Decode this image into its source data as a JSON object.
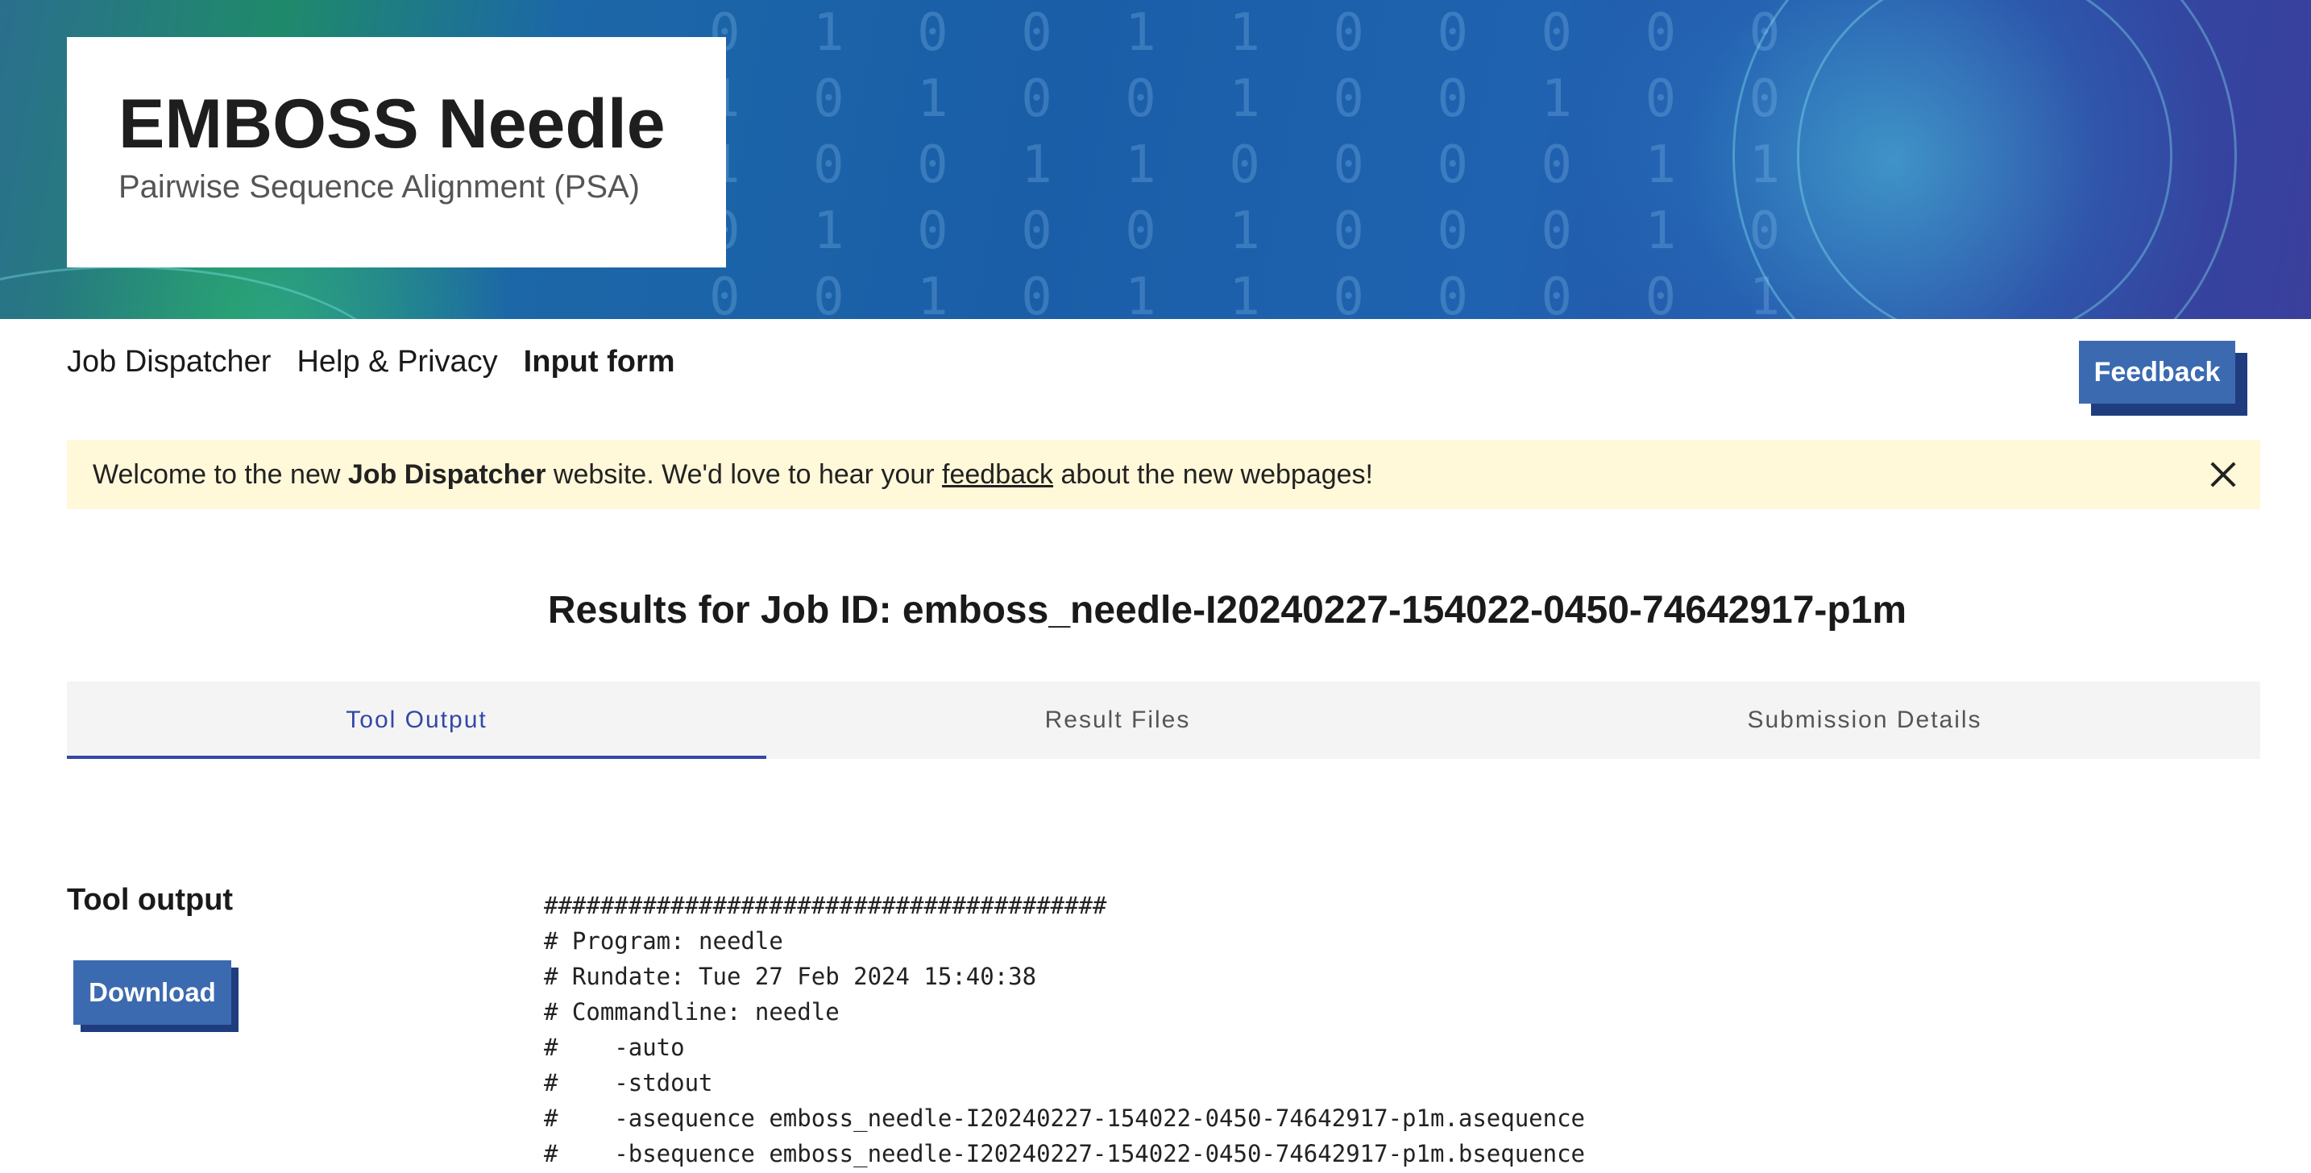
{
  "header": {
    "title": "EMBOSS Needle",
    "subtitle": "Pairwise Sequence Alignment (PSA)"
  },
  "nav": {
    "items": [
      {
        "label": "Job Dispatcher",
        "active": false
      },
      {
        "label": "Help & Privacy",
        "active": false
      },
      {
        "label": "Input form",
        "active": true
      }
    ],
    "feedback_label": "Feedback"
  },
  "banner": {
    "text_before": "Welcome to the new ",
    "bold": "Job Dispatcher",
    "text_middle": " website. We'd love to hear your ",
    "link": "feedback",
    "text_after": " about the new webpages!",
    "close_icon": "close-icon"
  },
  "results": {
    "title": "Results for Job ID: emboss_needle-I20240227-154022-0450-74642917-p1m"
  },
  "tabs": [
    {
      "label": "Tool Output",
      "active": true
    },
    {
      "label": "Result Files",
      "active": false
    },
    {
      "label": "Submission Details",
      "active": false
    }
  ],
  "tool_output": {
    "heading": "Tool output",
    "download_label": "Download",
    "lines": [
      "########################################",
      "# Program: needle",
      "# Rundate: Tue 27 Feb 2024 15:40:38",
      "# Commandline: needle",
      "#    -auto",
      "#    -stdout",
      "#    -asequence emboss_needle-I20240227-154022-0450-74642917-p1m.asequence",
      "#    -bsequence emboss_needle-I20240227-154022-0450-74642917-p1m.bsequence"
    ]
  },
  "colors": {
    "accent": "#3347a6",
    "button": "#3b6ab0",
    "button_shadow": "#1f3d7e",
    "banner_bg": "#fff8d9"
  }
}
